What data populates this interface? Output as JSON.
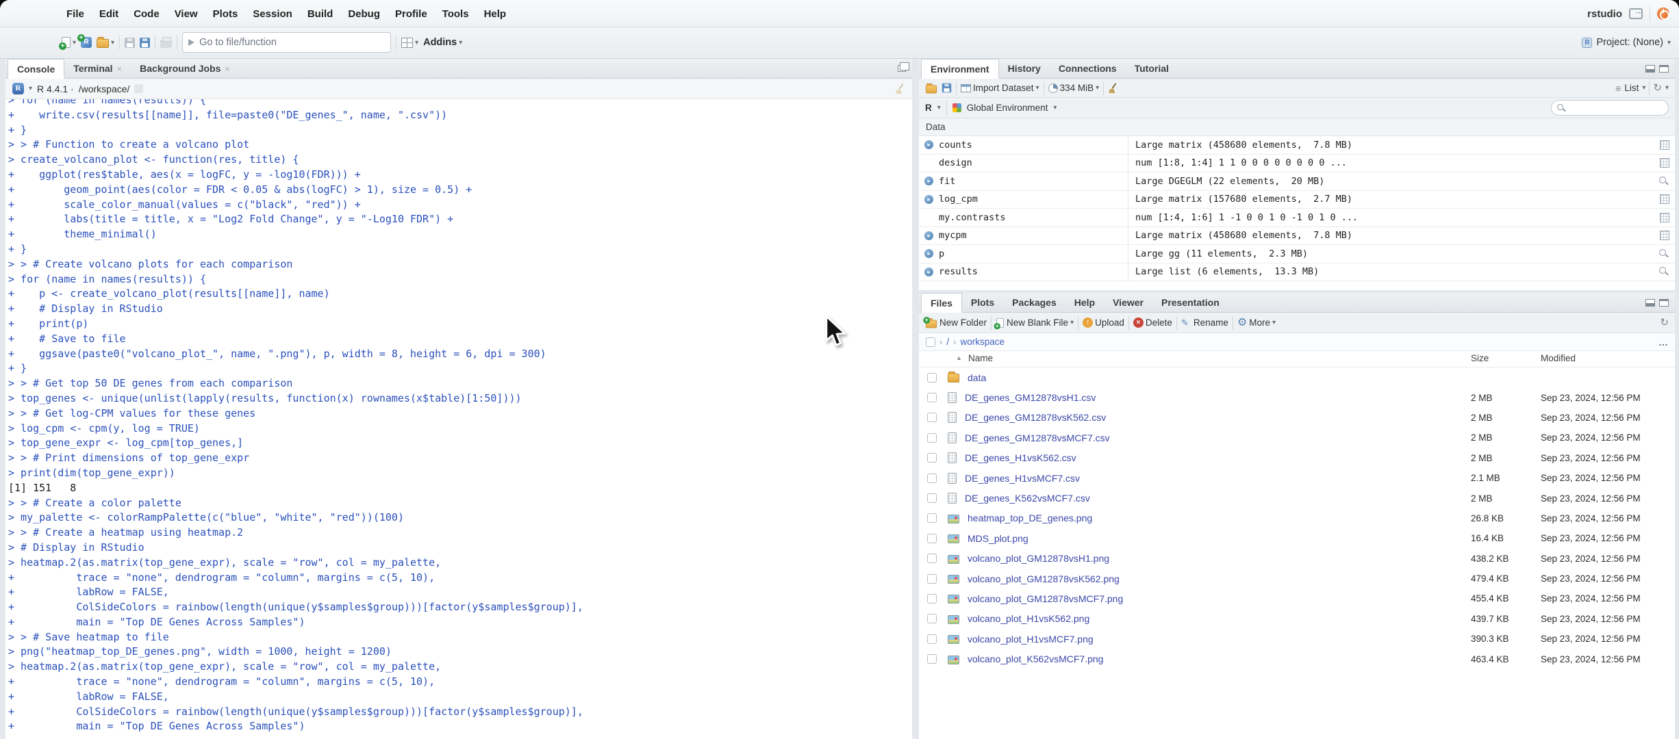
{
  "colors": {
    "console-code": "#2a50bb",
    "console-output": "#1a1a1a",
    "file-link": "#3b47a9",
    "crumb-link": "#3f63c0"
  },
  "menubar": {
    "items": [
      "File",
      "Edit",
      "Code",
      "View",
      "Plots",
      "Session",
      "Build",
      "Debug",
      "Profile",
      "Tools",
      "Help"
    ],
    "username": "rstudio"
  },
  "toolbar": {
    "goto_placeholder": "Go to file/function",
    "addins_label": "Addins",
    "project_label": "Project: (None)"
  },
  "console_pane": {
    "tabs": [
      {
        "label": "Console",
        "state": "active",
        "closable": ""
      },
      {
        "label": "Terminal",
        "state": "",
        "closable": "closable"
      },
      {
        "label": "Background Jobs",
        "state": "",
        "closable": "closable"
      }
    ],
    "version_label": "R 4.4.1 ·",
    "path_label": "/workspace/",
    "lines": [
      {
        "type": "code",
        "text": "> for (name in names(results)) {"
      },
      {
        "type": "code",
        "text": "+    write.csv(results[[name]], file=paste0(\"DE_genes_\", name, \".csv\"))"
      },
      {
        "type": "code",
        "text": "+ }"
      },
      {
        "type": "code",
        "text": "> > # Function to create a volcano plot"
      },
      {
        "type": "code",
        "text": "> create_volcano_plot <- function(res, title) {"
      },
      {
        "type": "code",
        "text": "+    ggplot(res$table, aes(x = logFC, y = -log10(FDR))) +"
      },
      {
        "type": "code",
        "text": "+        geom_point(aes(color = FDR < 0.05 & abs(logFC) > 1), size = 0.5) +"
      },
      {
        "type": "code",
        "text": "+        scale_color_manual(values = c(\"black\", \"red\")) +"
      },
      {
        "type": "code",
        "text": "+        labs(title = title, x = \"Log2 Fold Change\", y = \"-Log10 FDR\") +"
      },
      {
        "type": "code",
        "text": "+        theme_minimal()"
      },
      {
        "type": "code",
        "text": "+ }"
      },
      {
        "type": "code",
        "text": "> > # Create volcano plots for each comparison"
      },
      {
        "type": "code",
        "text": "> for (name in names(results)) {"
      },
      {
        "type": "code",
        "text": "+    p <- create_volcano_plot(results[[name]], name)"
      },
      {
        "type": "code",
        "text": "+    # Display in RStudio"
      },
      {
        "type": "code",
        "text": "+    print(p)"
      },
      {
        "type": "code",
        "text": "+    # Save to file"
      },
      {
        "type": "code",
        "text": "+    ggsave(paste0(\"volcano_plot_\", name, \".png\"), p, width = 8, height = 6, dpi = 300)"
      },
      {
        "type": "code",
        "text": "+ }"
      },
      {
        "type": "code",
        "text": "> > # Get top 50 DE genes from each comparison"
      },
      {
        "type": "code",
        "text": "> top_genes <- unique(unlist(lapply(results, function(x) rownames(x$table)[1:50])))"
      },
      {
        "type": "code",
        "text": "> > # Get log-CPM values for these genes"
      },
      {
        "type": "code",
        "text": "> log_cpm <- cpm(y, log = TRUE)"
      },
      {
        "type": "code",
        "text": "> top_gene_expr <- log_cpm[top_genes,]"
      },
      {
        "type": "code",
        "text": "> > # Print dimensions of top_gene_expr"
      },
      {
        "type": "code",
        "text": "> print(dim(top_gene_expr))"
      },
      {
        "type": "output",
        "text": "[1] 151   8"
      },
      {
        "type": "code",
        "text": "> > # Create a color palette"
      },
      {
        "type": "code",
        "text": "> my_palette <- colorRampPalette(c(\"blue\", \"white\", \"red\"))(100)"
      },
      {
        "type": "code",
        "text": "> > # Create a heatmap using heatmap.2"
      },
      {
        "type": "code",
        "text": "> # Display in RStudio"
      },
      {
        "type": "code",
        "text": "> heatmap.2(as.matrix(top_gene_expr), scale = \"row\", col = my_palette,"
      },
      {
        "type": "code",
        "text": "+          trace = \"none\", dendrogram = \"column\", margins = c(5, 10),"
      },
      {
        "type": "code",
        "text": "+          labRow = FALSE,"
      },
      {
        "type": "code",
        "text": "+          ColSideColors = rainbow(length(unique(y$samples$group)))[factor(y$samples$group)],"
      },
      {
        "type": "code",
        "text": "+          main = \"Top DE Genes Across Samples\")"
      },
      {
        "type": "code",
        "text": "> > # Save heatmap to file"
      },
      {
        "type": "code",
        "text": "> png(\"heatmap_top_DE_genes.png\", width = 1000, height = 1200)"
      },
      {
        "type": "code",
        "text": "> heatmap.2(as.matrix(top_gene_expr), scale = \"row\", col = my_palette,"
      },
      {
        "type": "code",
        "text": "+          trace = \"none\", dendrogram = \"column\", margins = c(5, 10),"
      },
      {
        "type": "code",
        "text": "+          labRow = FALSE,"
      },
      {
        "type": "code",
        "text": "+          ColSideColors = rainbow(length(unique(y$samples$group)))[factor(y$samples$group)],"
      },
      {
        "type": "code",
        "text": "+          main = \"Top DE Genes Across Samples\")"
      }
    ]
  },
  "environment_pane": {
    "tabs": [
      {
        "label": "Environment",
        "state": "active"
      },
      {
        "label": "History",
        "state": ""
      },
      {
        "label": "Connections",
        "state": ""
      },
      {
        "label": "Tutorial",
        "state": ""
      }
    ],
    "toolbar": {
      "import_label": "Import Dataset",
      "memory_label": "334 MiB",
      "list_label": "List"
    },
    "scope": {
      "language_label": "R",
      "env_label": "Global Environment"
    },
    "section_label": "Data",
    "objects": [
      {
        "name": "counts",
        "value": "Large matrix (458680 elements,  7.8 MB)",
        "icon": "grid",
        "expand": "expandable"
      },
      {
        "name": "design",
        "value": "num [1:8, 1:4] 1 1 0 0 0 0 0 0 0 0 ...",
        "icon": "grid",
        "expand": ""
      },
      {
        "name": "fit",
        "value": "Large DGEGLM (22 elements,  20 MB)",
        "icon": "search",
        "expand": "expandable"
      },
      {
        "name": "log_cpm",
        "value": "Large matrix (157680 elements,  2.7 MB)",
        "icon": "grid",
        "expand": "expandable"
      },
      {
        "name": "my.contrasts",
        "value": "num [1:4, 1:6] 1 -1 0 0 1 0 -1 0 1 0 ...",
        "icon": "grid",
        "expand": ""
      },
      {
        "name": "mycpm",
        "value": "Large matrix (458680 elements,  7.8 MB)",
        "icon": "grid",
        "expand": "expandable"
      },
      {
        "name": "p",
        "value": "Large gg (11 elements,  2.3 MB)",
        "icon": "search",
        "expand": "expandable"
      },
      {
        "name": "results",
        "value": "Large list (6 elements,  13.3 MB)",
        "icon": "search",
        "expand": "expandable"
      }
    ]
  },
  "files_pane": {
    "tabs": [
      {
        "label": "Files",
        "state": "active"
      },
      {
        "label": "Plots",
        "state": ""
      },
      {
        "label": "Packages",
        "state": ""
      },
      {
        "label": "Help",
        "state": ""
      },
      {
        "label": "Viewer",
        "state": ""
      },
      {
        "label": "Presentation",
        "state": ""
      }
    ],
    "toolbar": {
      "new_folder": "New Folder",
      "new_blank_file": "New Blank File",
      "upload": "Upload",
      "delete": "Delete",
      "rename": "Rename",
      "more": "More"
    },
    "breadcrumb": {
      "root": "/",
      "folder": "workspace",
      "more": "…"
    },
    "columns": {
      "name": "Name",
      "size": "Size",
      "modified": "Modified"
    },
    "rows": [
      {
        "kind": "folder",
        "name": "data",
        "size": "",
        "modified": ""
      },
      {
        "kind": "csv",
        "name": "DE_genes_GM12878vsH1.csv",
        "size": "2 MB",
        "modified": "Sep 23, 2024, 12:56 PM"
      },
      {
        "kind": "csv",
        "name": "DE_genes_GM12878vsK562.csv",
        "size": "2 MB",
        "modified": "Sep 23, 2024, 12:56 PM"
      },
      {
        "kind": "csv",
        "name": "DE_genes_GM12878vsMCF7.csv",
        "size": "2 MB",
        "modified": "Sep 23, 2024, 12:56 PM"
      },
      {
        "kind": "csv",
        "name": "DE_genes_H1vsK562.csv",
        "size": "2 MB",
        "modified": "Sep 23, 2024, 12:56 PM"
      },
      {
        "kind": "csv",
        "name": "DE_genes_H1vsMCF7.csv",
        "size": "2.1 MB",
        "modified": "Sep 23, 2024, 12:56 PM"
      },
      {
        "kind": "csv",
        "name": "DE_genes_K562vsMCF7.csv",
        "size": "2 MB",
        "modified": "Sep 23, 2024, 12:56 PM"
      },
      {
        "kind": "image",
        "name": "heatmap_top_DE_genes.png",
        "size": "26.8 KB",
        "modified": "Sep 23, 2024, 12:56 PM"
      },
      {
        "kind": "image",
        "name": "MDS_plot.png",
        "size": "16.4 KB",
        "modified": "Sep 23, 2024, 12:56 PM"
      },
      {
        "kind": "image",
        "name": "volcano_plot_GM12878vsH1.png",
        "size": "438.2 KB",
        "modified": "Sep 23, 2024, 12:56 PM"
      },
      {
        "kind": "image",
        "name": "volcano_plot_GM12878vsK562.png",
        "size": "479.4 KB",
        "modified": "Sep 23, 2024, 12:56 PM"
      },
      {
        "kind": "image",
        "name": "volcano_plot_GM12878vsMCF7.png",
        "size": "455.4 KB",
        "modified": "Sep 23, 2024, 12:56 PM"
      },
      {
        "kind": "image",
        "name": "volcano_plot_H1vsK562.png",
        "size": "439.7 KB",
        "modified": "Sep 23, 2024, 12:56 PM"
      },
      {
        "kind": "image",
        "name": "volcano_plot_H1vsMCF7.png",
        "size": "390.3 KB",
        "modified": "Sep 23, 2024, 12:56 PM"
      },
      {
        "kind": "image",
        "name": "volcano_plot_K562vsMCF7.png",
        "size": "463.4 KB",
        "modified": "Sep 23, 2024, 12:56 PM"
      }
    ]
  }
}
